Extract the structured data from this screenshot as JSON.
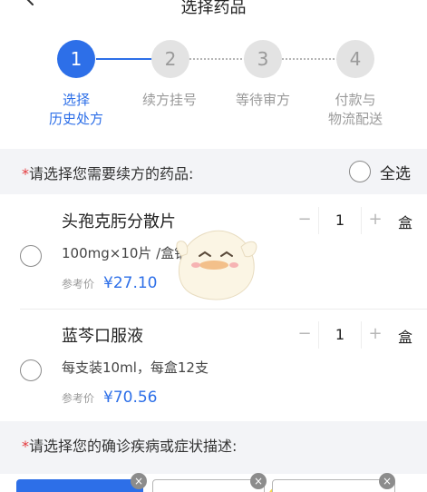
{
  "header": {
    "title": "选择药品"
  },
  "steps": [
    {
      "num": "1",
      "label_line1": "选择",
      "label_line2": "历史处方"
    },
    {
      "num": "2",
      "label_line1": "续方挂号",
      "label_line2": ""
    },
    {
      "num": "3",
      "label_line1": "等待审方",
      "label_line2": ""
    },
    {
      "num": "4",
      "label_line1": "付款与",
      "label_line2": "物流配送"
    }
  ],
  "drug_section": {
    "required_mark": "*",
    "title": "请选择您需要续方的药品:",
    "select_all_label": "全选"
  },
  "products": [
    {
      "name": "头孢克肟分散片",
      "spec": "100mg×10片 /盒铝",
      "price_label": "参考价",
      "price": "¥27.10",
      "quantity": "1",
      "minus": "−",
      "plus": "+",
      "unit": "盒"
    },
    {
      "name": "蓝芩口服液",
      "spec": "每支装10ml，每盒12支",
      "price_label": "参考价",
      "price": "¥70.56",
      "quantity": "1",
      "minus": "−",
      "plus": "+",
      "unit": "盒"
    }
  ],
  "diagnosis_section": {
    "required_mark": "*",
    "title": "请选择您的确诊疾病或症状描述:"
  },
  "chips": [
    {
      "remove": "×"
    },
    {
      "remove": "×"
    },
    {
      "remove": "×"
    }
  ],
  "colors": {
    "accent": "#2d6fe8",
    "required": "#e4393c",
    "section_bg": "#f3f4f7"
  },
  "icons": {
    "back": "chevron-left-icon",
    "remove": "close-icon"
  }
}
